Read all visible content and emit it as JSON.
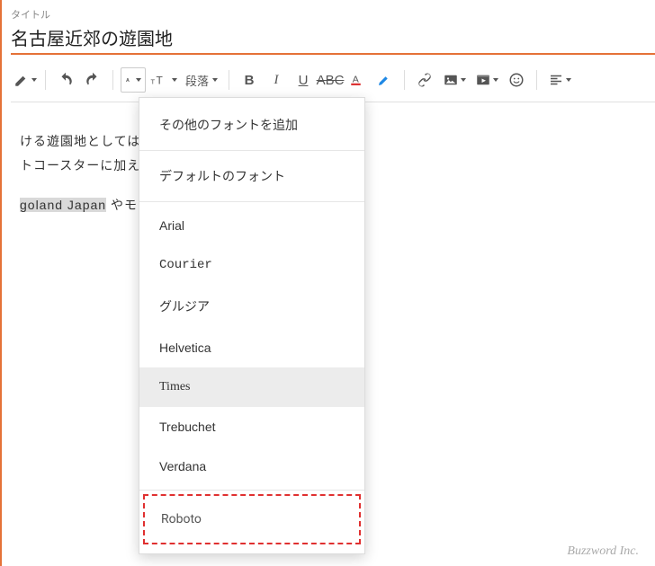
{
  "title_label": "タイトル",
  "title_value": "名古屋近郊の遊園地",
  "toolbar": {
    "paragraph_label": "段落"
  },
  "content": {
    "p1": "ける遊園地としては隣の県になりますがナガシ",
    "p1b": "トコースターに加えて、夏は大きなプールが利",
    "p2a": "goland Japan",
    "p2b": " やモンキーパークなどの施設があ"
  },
  "dropdown": {
    "add_more": "その他のフォントを追加",
    "default": "デフォルトのフォント",
    "fonts": {
      "arial": "Arial",
      "courier": "Courier",
      "georgia": "グルジア",
      "helvetica": "Helvetica",
      "times": "Times",
      "trebuchet": "Trebuchet",
      "verdana": "Verdana",
      "roboto": "Roboto"
    }
  },
  "footer": "Buzzword Inc."
}
